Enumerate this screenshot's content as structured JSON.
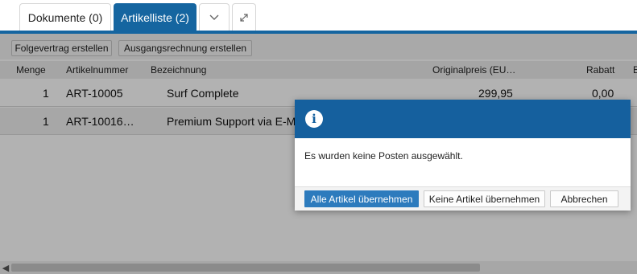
{
  "tabs": {
    "dokumente": "Dokumente (0)",
    "artikelliste": "Artikelliste (2)",
    "chevron_icon": "chevron-down-icon",
    "expand_icon": "expand-icon"
  },
  "toolbar": {
    "folgevertrag": "Folgevertrag erstellen",
    "ausgangsrechnung": "Ausgangsrechnung erstellen"
  },
  "table": {
    "columns": [
      "Menge",
      "Artikelnummer",
      "Bezeichnung",
      "Originalpreis (EU…",
      "Rabatt",
      "E"
    ],
    "rows": [
      {
        "menge": "1",
        "artikelnummer": "ART-10005",
        "bezeichnung": "Surf Complete",
        "originalpreis": "299,95",
        "rabatt": "0,00"
      },
      {
        "menge": "1",
        "artikelnummer": "ART-10016…",
        "bezeichnung": "Premium Support via E-M",
        "originalpreis": "",
        "rabatt": ""
      }
    ]
  },
  "dialog": {
    "icon": "info-icon",
    "message": "Es wurden keine Posten ausgewählt.",
    "buttons": {
      "alle": "Alle Artikel übernehmen",
      "keine": "Keine Artikel übernehmen",
      "abbrechen": "Abbrechen"
    }
  },
  "colors": {
    "accent": "#1565a0",
    "dialog_header": "#15609e",
    "primary_button": "#2d7bbd"
  }
}
